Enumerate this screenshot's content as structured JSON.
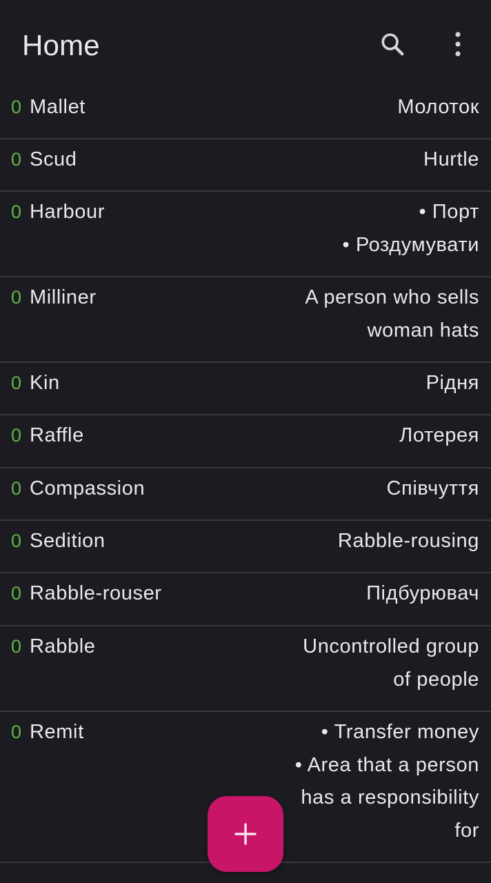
{
  "appbar": {
    "title": "Home",
    "search_icon": "search-icon",
    "more_icon": "more-vertical-icon"
  },
  "colors": {
    "background": "#1c1b21",
    "count": "#5fb346",
    "fab": "#c81568",
    "divider": "#3a393f"
  },
  "words": [
    {
      "count": "0",
      "word": "Mallet",
      "translation": [
        "Молоток"
      ]
    },
    {
      "count": "0",
      "word": "Scud",
      "translation": [
        "Hurtle"
      ]
    },
    {
      "count": "0",
      "word": "Harbour",
      "translation": [
        "• Порт",
        "• Роздумувати"
      ]
    },
    {
      "count": "0",
      "word": "Milliner",
      "translation": [
        "A person who sells",
        "woman hats"
      ]
    },
    {
      "count": "0",
      "word": "Kin",
      "translation": [
        "Рідня"
      ]
    },
    {
      "count": "0",
      "word": "Raffle",
      "translation": [
        "Лотерея"
      ]
    },
    {
      "count": "0",
      "word": "Compassion",
      "translation": [
        "Співчуття"
      ]
    },
    {
      "count": "0",
      "word": "Sedition",
      "translation": [
        "Rabble-rousing"
      ]
    },
    {
      "count": "0",
      "word": "Rabble-rouser",
      "translation": [
        "Підбурювач"
      ]
    },
    {
      "count": "0",
      "word": "Rabble",
      "translation": [
        "Uncontrolled group",
        "of people"
      ]
    },
    {
      "count": "0",
      "word": "Remit",
      "translation": [
        "• Transfer money",
        "• Area that a person",
        "has a responsibility",
        "for"
      ]
    }
  ],
  "fab": {
    "icon": "plus-icon"
  }
}
